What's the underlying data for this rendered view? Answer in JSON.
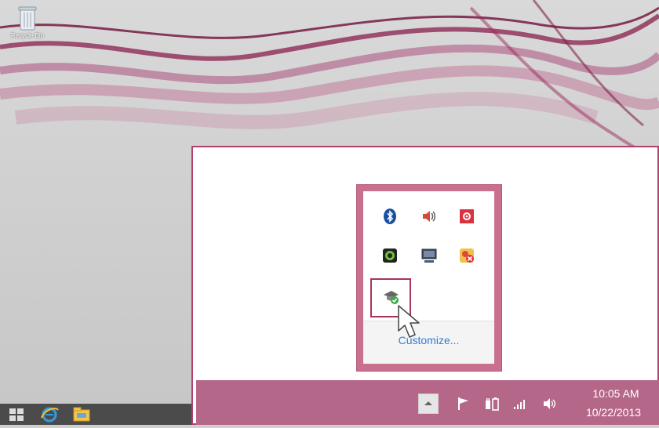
{
  "desktop": {
    "recycle_bin_label": "Recycle Bin"
  },
  "taskbar_left": {
    "items": [
      "start-button",
      "internet-explorer",
      "file-explorer"
    ]
  },
  "tray_popup": {
    "icons": [
      "bluetooth-icon",
      "volume-icon",
      "red-settings-icon",
      "webcam-icon",
      "display-icon",
      "network-error-icon",
      "graduation-cap-icon"
    ],
    "customize_label": "Customize..."
  },
  "taskbar_right": {
    "time": "10:05 AM",
    "date": "10/22/2013"
  },
  "colors": {
    "accent": "#b5678a",
    "highlight": "#a8325e",
    "link": "#2f7fd6"
  }
}
